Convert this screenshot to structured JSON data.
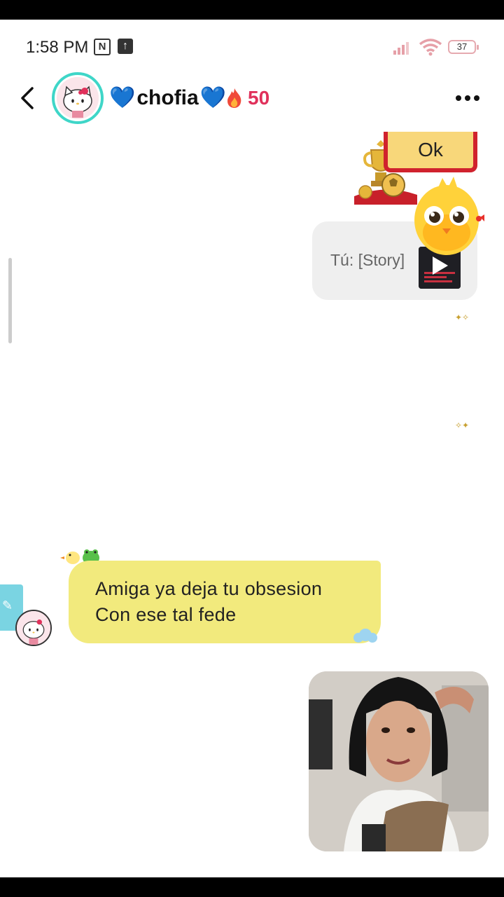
{
  "status_bar": {
    "time": "1:58 PM",
    "n_icon": "N",
    "upload_icon": "↑",
    "battery_level": "37"
  },
  "header": {
    "contact_name": "chofia",
    "name_emoji": "💙",
    "streak_icon": "fire-icon",
    "streak_count": "50"
  },
  "messages": {
    "sticker_ok_text": "Ok",
    "story_reply_label": "Tú: [Story]",
    "incoming_line1": "Amiga ya deja tu obsesion",
    "incoming_line2": "Con ese tal fede"
  },
  "colors": {
    "avatar_ring": "#3fd6c8",
    "streak": "#e0315b",
    "incoming_bubble": "#f2ea7d",
    "story_bubble": "#efefef"
  }
}
